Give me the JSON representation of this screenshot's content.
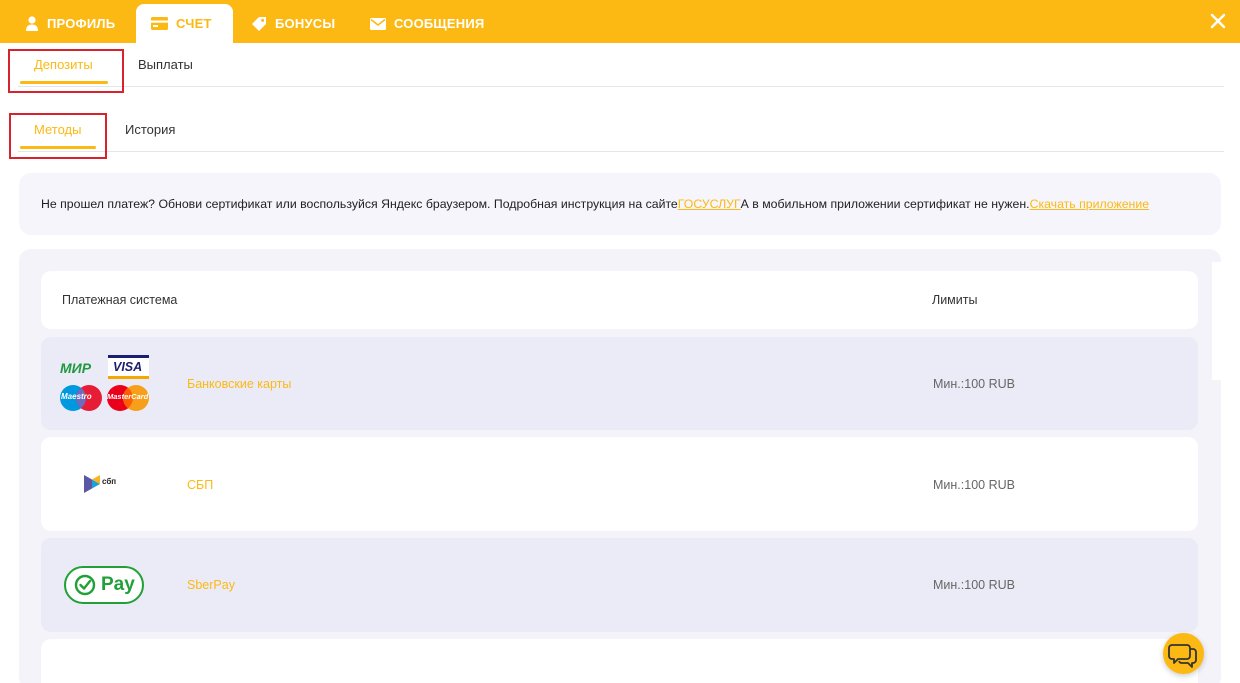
{
  "topnav": {
    "tabs": [
      {
        "label": "ПРОФИЛЬ",
        "icon": "user-icon"
      },
      {
        "label": "СЧЕТ",
        "icon": "wallet-icon",
        "active": true
      },
      {
        "label": "БОНУСЫ",
        "icon": "tag-icon"
      },
      {
        "label": "СООБЩЕНИЯ",
        "icon": "envelope-icon"
      }
    ],
    "close_icon": "close-icon"
  },
  "account_tabs": [
    {
      "label": "Депозиты",
      "active": true
    },
    {
      "label": "Выплаты"
    }
  ],
  "deposit_tabs": [
    {
      "label": "Методы",
      "active": true
    },
    {
      "label": "История"
    }
  ],
  "notice": {
    "text_1": "Не прошел платеж? Обнови сертификат или воспользуйся Яндекс браузером. Подробная инструкция на сайте ",
    "link_1": "ГОСУСЛУГ",
    "text_2": " А в мобильном приложении сертификат не нужен. ",
    "link_2": "Скачать приложение"
  },
  "table": {
    "headers": {
      "system": "Платежная система",
      "limits": "Лимиты"
    },
    "rows": [
      {
        "name": "Банковские карты",
        "limit": "Мин.:100 RUB",
        "logo": "bank-cards-logo",
        "logo_text": {
          "mir": "МИР",
          "visa": "VISA",
          "maestro": "Maestro",
          "mastercard": "MasterCard"
        }
      },
      {
        "name": "СБП",
        "limit": "Мин.:100 RUB",
        "logo": "sbp-logo",
        "logo_text": {
          "sbp": "сбп"
        }
      },
      {
        "name": "SberPay",
        "limit": "Мин.:100 RUB",
        "logo": "sberpay-logo",
        "logo_text": {
          "pay": "Pay"
        }
      }
    ]
  },
  "chat_button": {
    "icon": "chat-icon"
  },
  "colors": {
    "accent": "#fcb913",
    "highlight_frame": "#d6232e",
    "panel": "#f3f3f9",
    "row_tint": "#ebebf7"
  }
}
